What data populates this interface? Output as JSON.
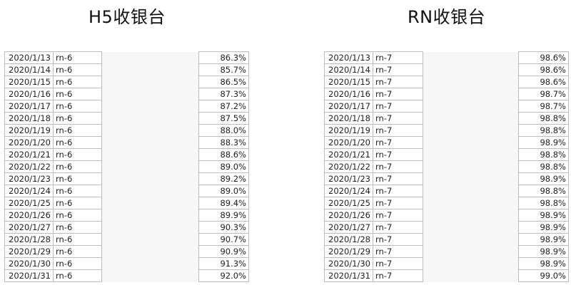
{
  "titles": {
    "left": "H5收银台",
    "right": "RN收银台"
  },
  "tables": {
    "h5": {
      "rows": [
        {
          "date": "2020/1/13",
          "tag": "rn-6",
          "pct": "86.3%"
        },
        {
          "date": "2020/1/14",
          "tag": "rn-6",
          "pct": "85.7%"
        },
        {
          "date": "2020/1/15",
          "tag": "rn-6",
          "pct": "86.5%"
        },
        {
          "date": "2020/1/16",
          "tag": "rn-6",
          "pct": "87.3%"
        },
        {
          "date": "2020/1/17",
          "tag": "rn-6",
          "pct": "87.2%"
        },
        {
          "date": "2020/1/18",
          "tag": "rn-6",
          "pct": "87.5%"
        },
        {
          "date": "2020/1/19",
          "tag": "rn-6",
          "pct": "88.0%"
        },
        {
          "date": "2020/1/20",
          "tag": "rn-6",
          "pct": "88.3%"
        },
        {
          "date": "2020/1/21",
          "tag": "rn-6",
          "pct": "88.6%"
        },
        {
          "date": "2020/1/22",
          "tag": "rn-6",
          "pct": "89.0%"
        },
        {
          "date": "2020/1/23",
          "tag": "rn-6",
          "pct": "89.2%"
        },
        {
          "date": "2020/1/24",
          "tag": "rn-6",
          "pct": "89.0%"
        },
        {
          "date": "2020/1/25",
          "tag": "rn-6",
          "pct": "89.4%"
        },
        {
          "date": "2020/1/26",
          "tag": "rn-6",
          "pct": "89.9%"
        },
        {
          "date": "2020/1/27",
          "tag": "rn-6",
          "pct": "90.3%"
        },
        {
          "date": "2020/1/28",
          "tag": "rn-6",
          "pct": "90.7%"
        },
        {
          "date": "2020/1/29",
          "tag": "rn-6",
          "pct": "90.9%"
        },
        {
          "date": "2020/1/30",
          "tag": "rn-6",
          "pct": "91.3%"
        },
        {
          "date": "2020/1/31",
          "tag": "rn-6",
          "pct": "92.0%"
        }
      ]
    },
    "rn": {
      "rows": [
        {
          "date": "2020/1/13",
          "tag": "rn-7",
          "pct": "98.6%"
        },
        {
          "date": "2020/1/14",
          "tag": "rn-7",
          "pct": "98.6%"
        },
        {
          "date": "2020/1/15",
          "tag": "rn-7",
          "pct": "98.6%"
        },
        {
          "date": "2020/1/16",
          "tag": "rn-7",
          "pct": "98.7%"
        },
        {
          "date": "2020/1/17",
          "tag": "rn-7",
          "pct": "98.7%"
        },
        {
          "date": "2020/1/18",
          "tag": "rn-7",
          "pct": "98.8%"
        },
        {
          "date": "2020/1/19",
          "tag": "rn-7",
          "pct": "98.8%"
        },
        {
          "date": "2020/1/20",
          "tag": "rn-7",
          "pct": "98.9%"
        },
        {
          "date": "2020/1/21",
          "tag": "rn-7",
          "pct": "98.8%"
        },
        {
          "date": "2020/1/22",
          "tag": "rn-7",
          "pct": "98.8%"
        },
        {
          "date": "2020/1/23",
          "tag": "rn-7",
          "pct": "98.9%"
        },
        {
          "date": "2020/1/24",
          "tag": "rn-7",
          "pct": "98.8%"
        },
        {
          "date": "2020/1/25",
          "tag": "rn-7",
          "pct": "98.8%"
        },
        {
          "date": "2020/1/26",
          "tag": "rn-7",
          "pct": "98.9%"
        },
        {
          "date": "2020/1/27",
          "tag": "rn-7",
          "pct": "98.9%"
        },
        {
          "date": "2020/1/28",
          "tag": "rn-7",
          "pct": "98.9%"
        },
        {
          "date": "2020/1/29",
          "tag": "rn-7",
          "pct": "98.9%"
        },
        {
          "date": "2020/1/30",
          "tag": "rn-7",
          "pct": "98.9%"
        },
        {
          "date": "2020/1/31",
          "tag": "rn-7",
          "pct": "99.0%"
        }
      ]
    }
  }
}
